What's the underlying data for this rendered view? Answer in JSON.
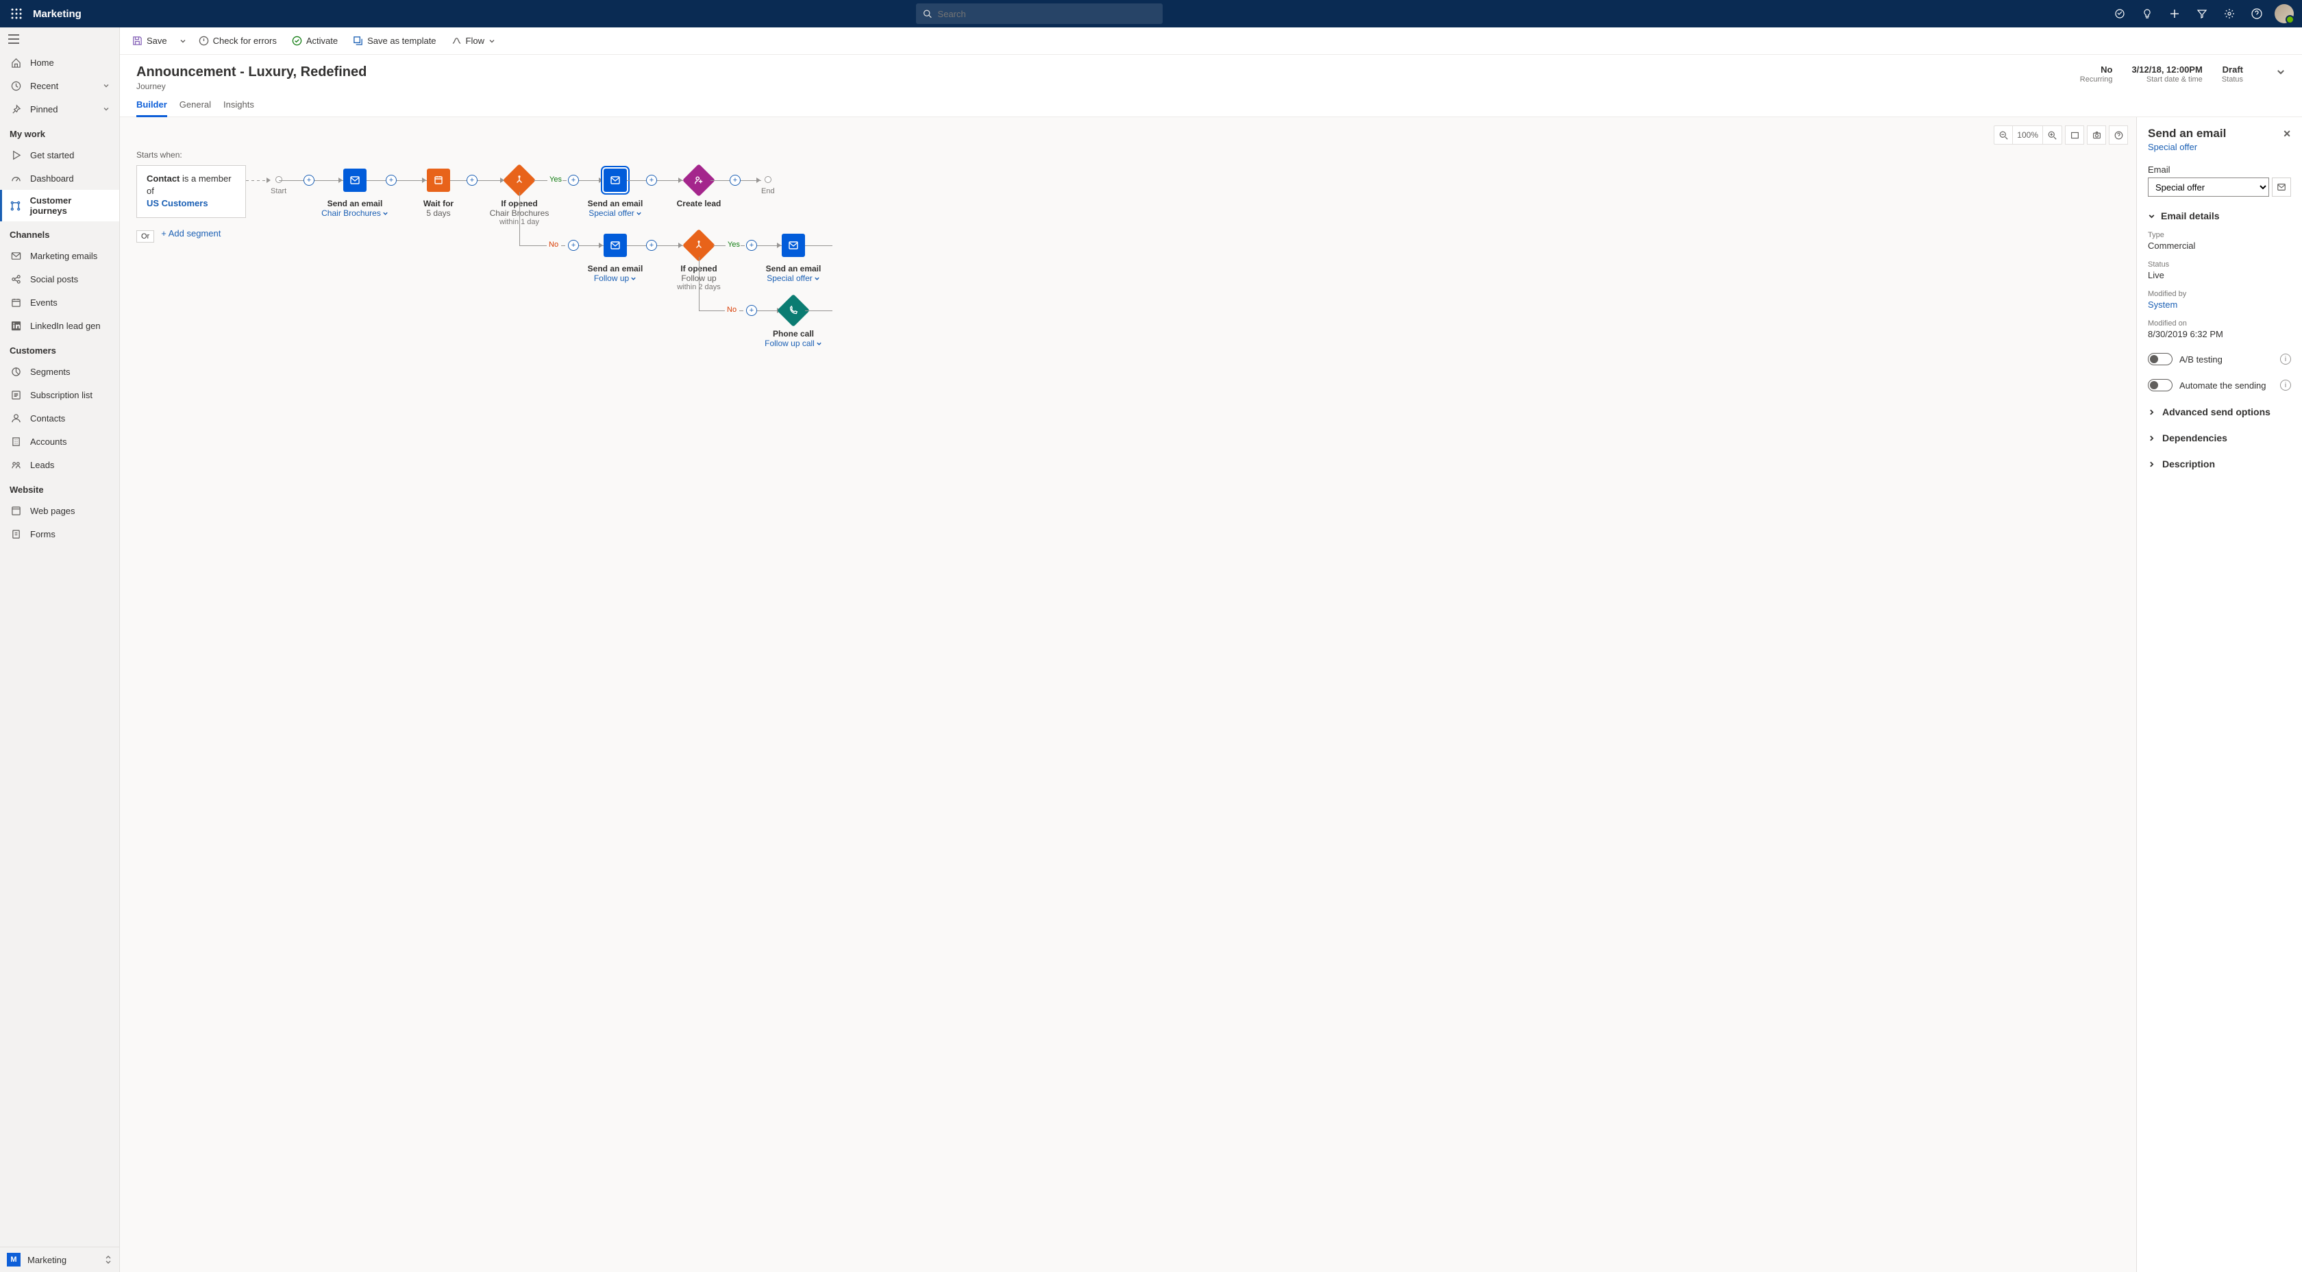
{
  "app": {
    "name": "Marketing",
    "search_placeholder": "Search"
  },
  "sidebar": {
    "top": [
      {
        "icon": "home-icon",
        "label": "Home"
      },
      {
        "icon": "clock-icon",
        "label": "Recent",
        "chevron": true
      },
      {
        "icon": "pin-icon",
        "label": "Pinned",
        "chevron": true
      }
    ],
    "sections": [
      {
        "title": "My work",
        "items": [
          {
            "icon": "play-icon",
            "label": "Get started"
          },
          {
            "icon": "gauge-icon",
            "label": "Dashboard"
          },
          {
            "icon": "journey-icon",
            "label": "Customer journeys",
            "active": true
          }
        ]
      },
      {
        "title": "Channels",
        "items": [
          {
            "icon": "mail-icon",
            "label": "Marketing emails"
          },
          {
            "icon": "share-icon",
            "label": "Social posts"
          },
          {
            "icon": "calendar-icon",
            "label": "Events"
          },
          {
            "icon": "linkedin-icon",
            "label": "LinkedIn lead gen"
          }
        ]
      },
      {
        "title": "Customers",
        "items": [
          {
            "icon": "segment-icon",
            "label": "Segments"
          },
          {
            "icon": "list-icon",
            "label": "Subscription list"
          },
          {
            "icon": "person-icon",
            "label": "Contacts"
          },
          {
            "icon": "building-icon",
            "label": "Accounts"
          },
          {
            "icon": "leads-icon",
            "label": "Leads"
          }
        ]
      },
      {
        "title": "Website",
        "items": [
          {
            "icon": "page-icon",
            "label": "Web pages"
          },
          {
            "icon": "form-icon",
            "label": "Forms"
          }
        ]
      }
    ],
    "footer": {
      "badge": "M",
      "label": "Marketing"
    }
  },
  "cmdbar": {
    "save": "Save",
    "check": "Check for errors",
    "activate": "Activate",
    "save_template": "Save as template",
    "flow": "Flow"
  },
  "header": {
    "title": "Announcement - Luxury, Redefined",
    "subtype": "Journey",
    "meta": [
      {
        "value": "No",
        "label": "Recurring"
      },
      {
        "value": "3/12/18, 12:00PM",
        "label": "Start date & time"
      },
      {
        "value": "Draft",
        "label": "Status"
      }
    ]
  },
  "tabs": [
    "Builder",
    "General",
    "Insights"
  ],
  "canvas": {
    "startsWhen": "Starts when:",
    "segment_prefix": "Contact",
    "segment_text": " is a member of ",
    "segment_link": "US Customers",
    "or": "Or",
    "add_segment": "+ Add segment",
    "start": "Start",
    "end": "End",
    "zoom": "100%",
    "yes": "Yes",
    "no": "No",
    "nodes": {
      "n1": {
        "title": "Send an email",
        "sub": "Chair Brochures"
      },
      "n2": {
        "title": "Wait for",
        "sub": "5 days"
      },
      "n3": {
        "title": "If opened",
        "sub": "Chair Brochures",
        "sub2": "within 1 day"
      },
      "n4": {
        "title": "Send an email",
        "sub": "Special offer"
      },
      "n5": {
        "title": "Create lead"
      },
      "n6": {
        "title": "Send an email",
        "sub": "Follow up"
      },
      "n7": {
        "title": "If opened",
        "sub": "Follow up",
        "sub2": "within 2 days"
      },
      "n8": {
        "title": "Send an email",
        "sub": "Special offer"
      },
      "n9": {
        "title": "Phone call",
        "sub": "Follow up call"
      }
    }
  },
  "panel": {
    "title": "Send an email",
    "subtitle_link": "Special offer",
    "email_label": "Email",
    "email_value": "Special offer",
    "details_header": "Email details",
    "fields": {
      "type_label": "Type",
      "type_value": "Commercial",
      "status_label": "Status",
      "status_value": "Live",
      "modby_label": "Modified by",
      "modby_value": "System",
      "modon_label": "Modified on",
      "modon_value": "8/30/2019  6:32 PM"
    },
    "ab_label": "A/B testing",
    "automate_label": "Automate the sending",
    "collapse": [
      "Advanced send options",
      "Dependencies",
      "Description"
    ]
  }
}
